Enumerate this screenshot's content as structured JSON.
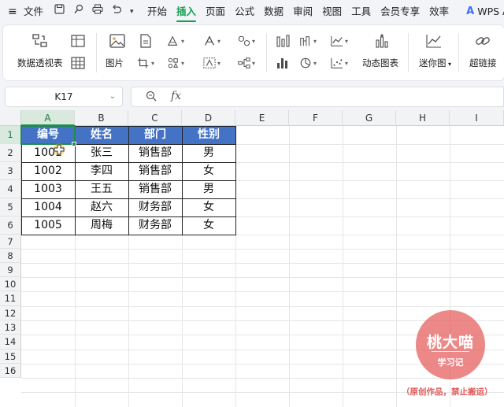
{
  "menubar": {
    "hamburger": "≡",
    "file_label": "文件",
    "quick_icons": [
      "save-icon",
      "wand-icon",
      "print-icon",
      "undo-icon"
    ],
    "tabs": [
      {
        "label": "开始",
        "active": false
      },
      {
        "label": "插入",
        "active": true
      },
      {
        "label": "页面",
        "active": false
      },
      {
        "label": "公式",
        "active": false
      },
      {
        "label": "数据",
        "active": false
      },
      {
        "label": "审阅",
        "active": false
      },
      {
        "label": "视图",
        "active": false
      },
      {
        "label": "工具",
        "active": false
      },
      {
        "label": "会员专享",
        "active": false
      },
      {
        "label": "效率",
        "active": false
      }
    ],
    "wps_ai_label": "WPS AI",
    "accent": "#14a051"
  },
  "ribbon": {
    "pivot_table_label": "数据透视表",
    "picture_label": "图片",
    "dynamic_chart_label": "动态图表",
    "sparkline_label": "迷你图",
    "hyperlink_label": "超链接"
  },
  "formula_bar": {
    "name_box": "K17",
    "fx": "fx",
    "formula": ""
  },
  "sheet": {
    "columns": [
      "A",
      "B",
      "C",
      "D",
      "E",
      "F",
      "G",
      "H",
      "I"
    ],
    "rows": [
      "1",
      "2",
      "3",
      "4",
      "5",
      "6",
      "7",
      "8",
      "9",
      "10",
      "11",
      "12",
      "13",
      "14",
      "15",
      "16"
    ],
    "table_headers": [
      "编号",
      "姓名",
      "部门",
      "性别"
    ],
    "table_rows": [
      [
        "1001",
        "张三",
        "销售部",
        "男"
      ],
      [
        "1002",
        "李四",
        "销售部",
        "女"
      ],
      [
        "1003",
        "王五",
        "销售部",
        "男"
      ],
      [
        "1004",
        "赵六",
        "财务部",
        "女"
      ],
      [
        "1005",
        "周梅",
        "财务部",
        "女"
      ]
    ],
    "header_fill": "#4472c4",
    "selected_cell": "A1"
  },
  "watermark": {
    "title": "桃大喵",
    "subtitle": "学习记",
    "note": "（原创作品，禁止搬运）",
    "color": "#e65a5a"
  }
}
